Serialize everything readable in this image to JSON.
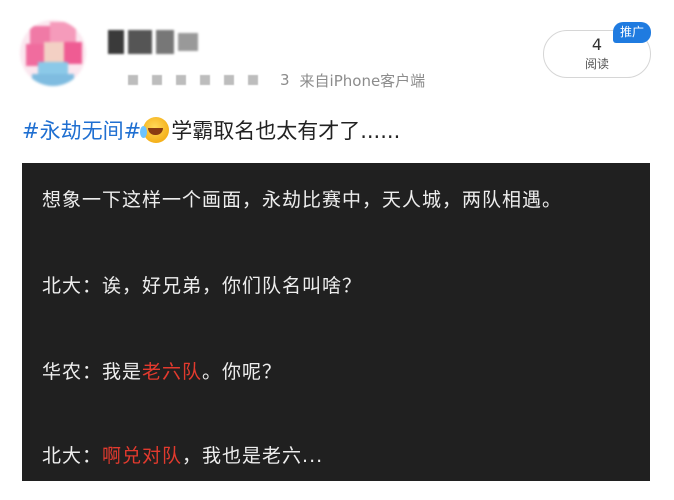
{
  "header": {
    "count": "3",
    "source": "来自iPhone客户端",
    "read_count": "4",
    "read_label": "阅读",
    "promo_badge": "推广"
  },
  "post": {
    "hashtag": "#永劫无间#",
    "emoji": "laughing-crying-emoji",
    "text": "学霸取名也太有才了......"
  },
  "dialog": {
    "line1": "想象一下这样一个画面，永劫比赛中，天人城，两队相遇。",
    "line2": "北大：诶，好兄弟，你们队名叫啥？",
    "line3_prefix": "华农：我是",
    "line3_highlight": "老六队",
    "line3_suffix": "。你呢？",
    "line4_prefix": "北大：",
    "line4_highlight": "啊兑对队",
    "line4_suffix": "，我也是老六..."
  },
  "colors": {
    "hashtag": "#1f6fd1",
    "highlight": "#e23a2e",
    "panel_bg": "#202020",
    "promo_bg": "#1f7be0"
  }
}
